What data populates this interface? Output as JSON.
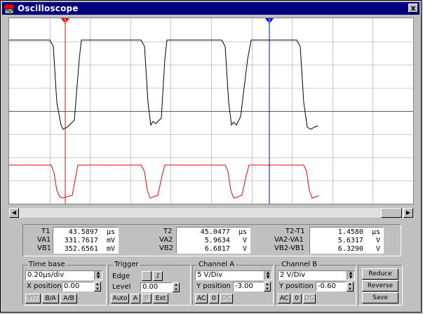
{
  "window": {
    "title": "Oscilloscope",
    "close_label": "x"
  },
  "cursors": {
    "t1_label": "1",
    "t2_label": "2"
  },
  "readout": {
    "left": {
      "labels": [
        "T1",
        "VA1",
        "VB1"
      ],
      "values": [
        "43.5897  µs",
        "331.7617  mV",
        "352.6561  mV"
      ]
    },
    "middle": {
      "labels": [
        "T2",
        "VA2",
        "VB2"
      ],
      "values": [
        "45.0477  µs",
        "5.9634   V",
        "6.6817   V"
      ]
    },
    "right": {
      "labels": [
        "T2-T1",
        "VA2-VA1",
        "VB2-VB1"
      ],
      "values": [
        "1.4580  µs",
        "5.6317   V",
        "6.3290   V"
      ]
    }
  },
  "timebase": {
    "title": "Time base",
    "scale": "0.20µs/div",
    "xpos_label": "X position",
    "xpos": "0.00",
    "modes": [
      "Y/T",
      "B/A",
      "A/B"
    ]
  },
  "trigger": {
    "title": "Trigger",
    "edge_label": "Edge",
    "level_label": "Level",
    "level": "0.00",
    "buttons": [
      "Auto",
      "A",
      "B",
      "Ext"
    ]
  },
  "channel_a": {
    "title": "Channel A",
    "scale": "5 V/Div",
    "ypos_label": "Y position",
    "ypos": "-3.00",
    "coupling": [
      "AC",
      "0",
      "DC"
    ]
  },
  "channel_b": {
    "title": "Channel B",
    "scale": "2 V/Div",
    "ypos_label": "Y position",
    "ypos": "-0.60",
    "coupling": [
      "AC",
      "0",
      "DC"
    ]
  },
  "side_buttons": [
    "Reduce",
    "Reverse",
    "Save"
  ],
  "colors": {
    "trace_a": "#000000",
    "trace_b": "#ff0000",
    "cursor1": "#ff0000",
    "cursor2": "#0000ff",
    "grid": "#a0a0a0"
  }
}
